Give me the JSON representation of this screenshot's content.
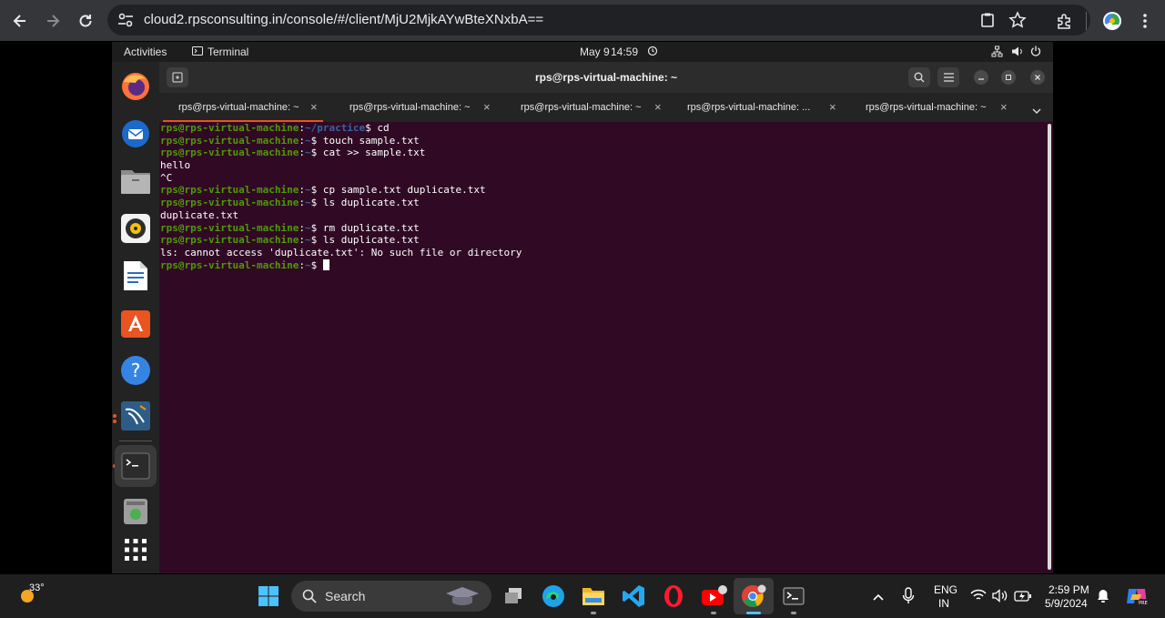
{
  "browser": {
    "url": "cloud2.rpsconsulting.in/console/#/client/MjU2MjkAYwBteXNxbA=="
  },
  "gnome": {
    "activities": "Activities",
    "app_name": "Terminal",
    "date": "May 9",
    "time": "14:59"
  },
  "terminal": {
    "title": "rps@rps-virtual-machine: ~",
    "tabs": [
      {
        "label": "rps@rps-virtual-machine: ~",
        "active": true
      },
      {
        "label": "rps@rps-virtual-machine: ~",
        "active": false
      },
      {
        "label": "rps@rps-virtual-machine: ~",
        "active": false
      },
      {
        "label": "rps@rps-virtual-machine: ...",
        "active": false
      },
      {
        "label": "rps@rps-virtual-machine: ~",
        "active": false
      }
    ],
    "lines": [
      {
        "user": "rps@rps-virtual-machine",
        "path": "~/practice",
        "cmd": "$ cd"
      },
      {
        "user": "rps@rps-virtual-machine",
        "path": "~",
        "cmd": "$ touch sample.txt"
      },
      {
        "user": "rps@rps-virtual-machine",
        "path": "~",
        "cmd": "$ cat >> sample.txt"
      },
      {
        "output": "hello"
      },
      {
        "output": "^C"
      },
      {
        "user": "rps@rps-virtual-machine",
        "path": "~",
        "cmd": "$ cp sample.txt duplicate.txt"
      },
      {
        "user": "rps@rps-virtual-machine",
        "path": "~",
        "cmd": "$ ls duplicate.txt"
      },
      {
        "output": "duplicate.txt"
      },
      {
        "user": "rps@rps-virtual-machine",
        "path": "~",
        "cmd": "$ rm duplicate.txt"
      },
      {
        "user": "rps@rps-virtual-machine",
        "path": "~",
        "cmd": "$ ls duplicate.txt"
      },
      {
        "output": "ls: cannot access 'duplicate.txt': No such file or directory"
      },
      {
        "user": "rps@rps-virtual-machine",
        "path": "~",
        "cmd": "$ ",
        "cursor": true
      }
    ]
  },
  "taskbar": {
    "weather_temp": "33°",
    "search_label": "Search",
    "lang_top": "ENG",
    "lang_bottom": "IN",
    "clock_time": "2:59 PM",
    "clock_date": "5/9/2024"
  },
  "colors": {
    "terminal_bg": "#300a24",
    "prompt_user": "#4e9a06",
    "prompt_path": "#3465a4",
    "accent": "#e95420"
  }
}
